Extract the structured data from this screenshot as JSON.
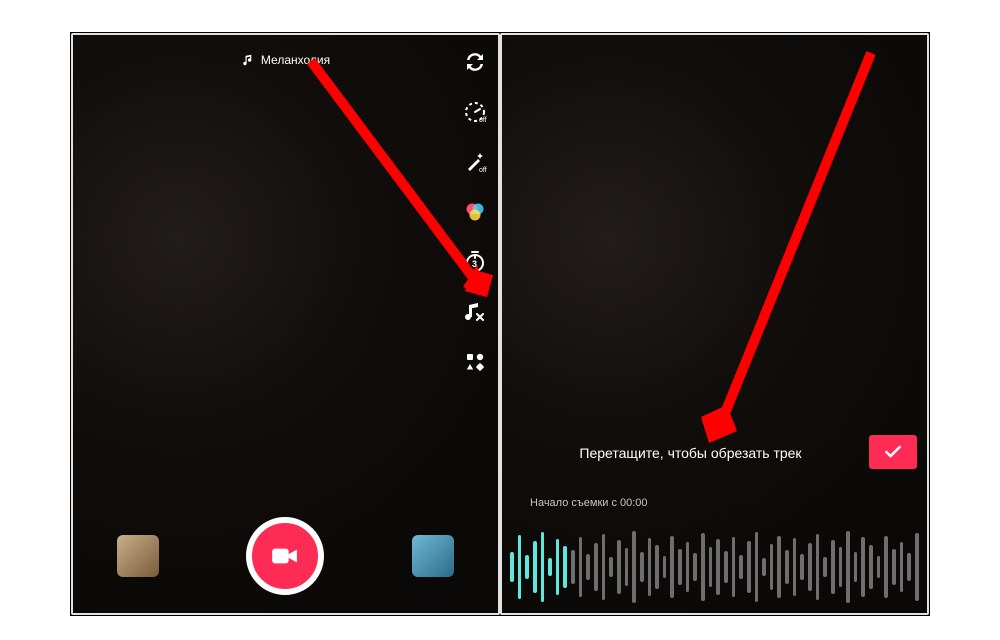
{
  "left": {
    "music_label": "Меланхолия",
    "tools": {
      "flip": "flip-icon",
      "speed": "speed-icon",
      "beauty": "beauty-icon",
      "filters": "filters-icon",
      "timer": "timer-icon",
      "soundcut": "sound-cut-icon",
      "more": "more-grid-icon"
    }
  },
  "right": {
    "trim_instruction": "Перетащите, чтобы обрезать трек",
    "start_label": "Начало съемки с 00:00"
  },
  "waveform_heights": [
    30,
    64,
    24,
    52,
    70,
    18,
    56,
    42,
    34,
    60,
    26,
    48,
    66,
    20,
    54,
    38,
    72,
    30,
    58,
    44,
    22,
    62,
    36,
    50,
    28,
    68,
    40,
    56,
    32,
    60,
    24,
    52,
    70,
    18,
    46,
    62,
    34,
    58,
    26,
    48,
    66,
    20,
    54,
    40,
    72,
    30,
    60,
    44,
    22,
    62,
    36,
    50,
    28,
    68
  ],
  "active_count": 8,
  "colors": {
    "accent": "#fe2c55"
  }
}
